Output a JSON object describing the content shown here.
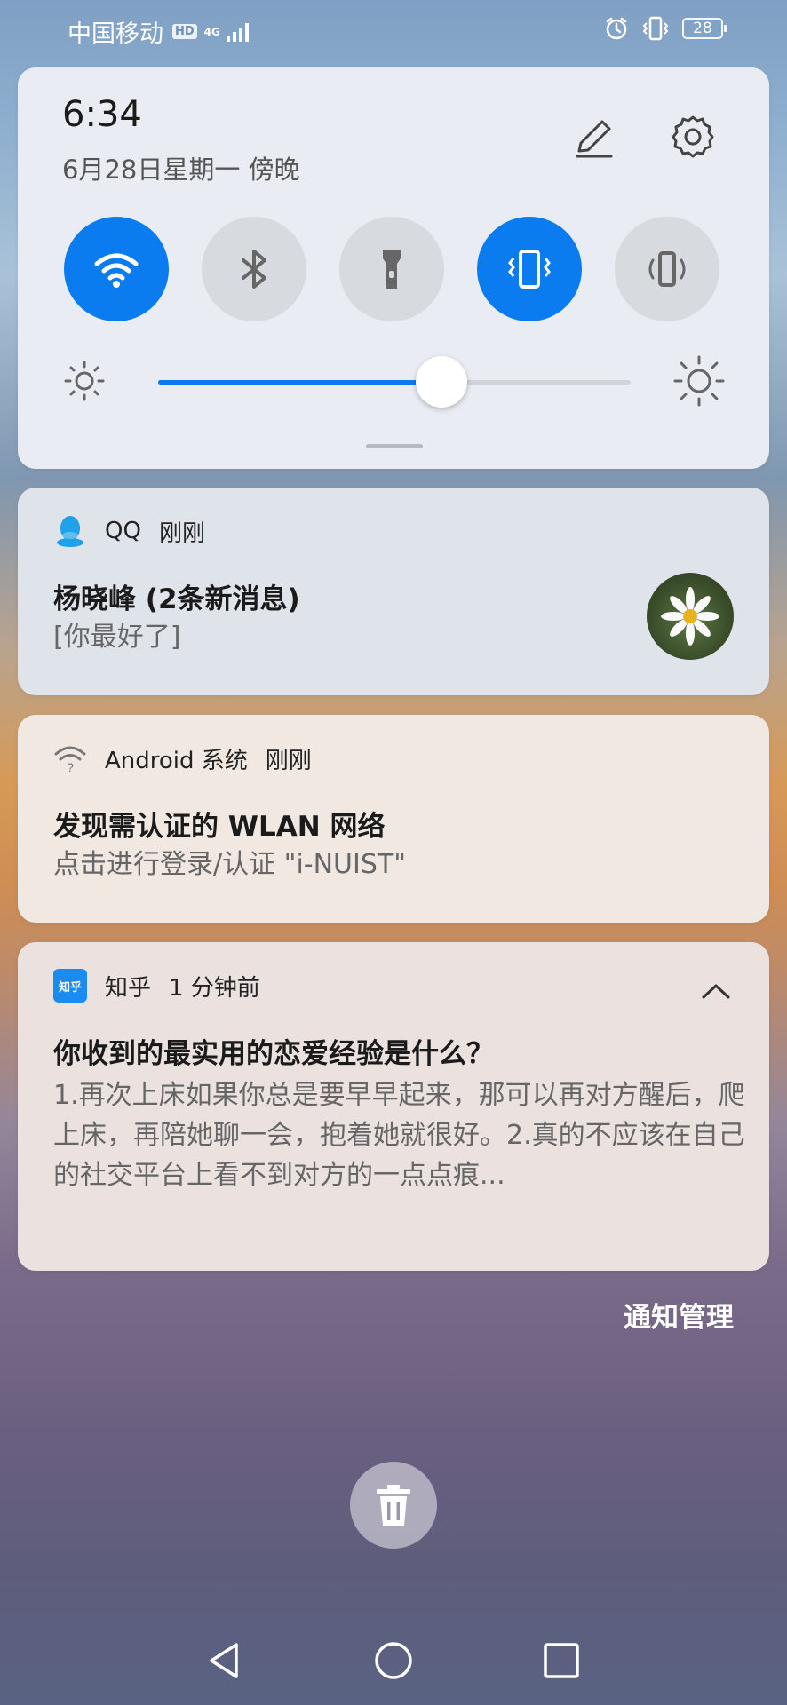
{
  "status_bar": {
    "carrier": "中国移动",
    "hd_badge": "HD",
    "network": "4G",
    "battery": "28",
    "icons": [
      "hd-icon",
      "signal-icon",
      "alarm-icon",
      "vibrate-icon",
      "battery-icon"
    ]
  },
  "quick_settings": {
    "time": "6:34",
    "date": "6月28日星期一 傍晚",
    "toggles": [
      {
        "name": "wifi",
        "icon": "wifi-icon",
        "on": true
      },
      {
        "name": "bluetooth",
        "icon": "bluetooth-icon",
        "on": false
      },
      {
        "name": "flashlight",
        "icon": "flashlight-icon",
        "on": false
      },
      {
        "name": "vibrate",
        "icon": "vibrate-icon",
        "on": true
      },
      {
        "name": "auto-rotate",
        "icon": "rotate-icon",
        "on": false
      }
    ],
    "brightness_level": 0.6,
    "accent_color": "#0a7cf0"
  },
  "notifications": [
    {
      "app": "QQ",
      "time": "刚刚",
      "title": "杨晓峰 (2条新消息)",
      "body": "[你最好了]",
      "icon": "qq-icon"
    },
    {
      "app": "Android 系统",
      "time": "刚刚",
      "title": "发现需认证的 WLAN 网络",
      "body": "点击进行登录/认证 \"i-NUIST\"",
      "icon": "wifi-question-icon"
    },
    {
      "app": "知乎",
      "app_icon_text": "知乎",
      "time": "1 分钟前",
      "title": "你收到的最实用的恋爱经验是什么？",
      "body": "1.再次上床如果你总是要早早起来，那可以再对方醒后，爬上床，再陪她聊一会，抱着她就很好。2.真的不应该在自己的社交平台上看不到对方的一点点痕...",
      "icon": "zhihu-icon"
    }
  ],
  "notif_manage": "通知管理"
}
